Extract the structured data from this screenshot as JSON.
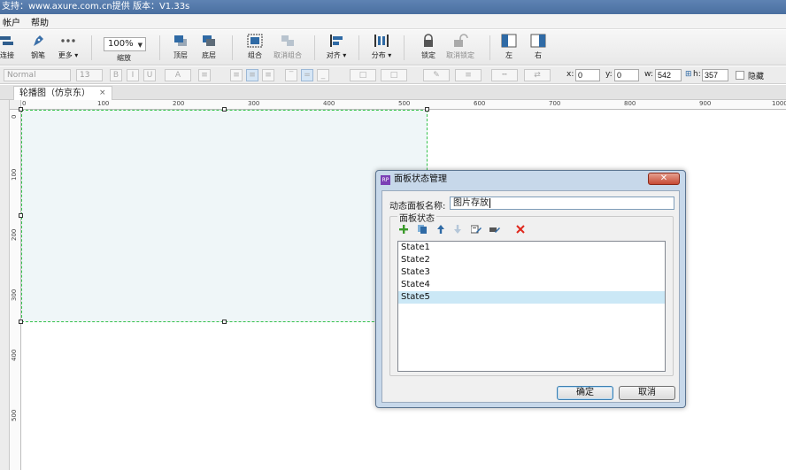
{
  "titlebar": {
    "text": "支持：www.axure.com.cn提供 版本：V1.33s"
  },
  "menu": {
    "items": [
      "帐户",
      "帮助"
    ]
  },
  "toolbar": {
    "buttons": {
      "connect": "连接",
      "pen": "钢笔",
      "more": "更多 ▾",
      "zoom_label": "缩放",
      "top": "顶层",
      "bottom": "底层",
      "group": "组合",
      "ungroup": "取消组合",
      "align": "对齐 ▾",
      "distribute": "分布 ▾",
      "lock": "锁定",
      "unlock": "取消锁定",
      "left": "左",
      "right": "右"
    },
    "zoom_value": "100%"
  },
  "format": {
    "font_style": "Normal",
    "font_size": "13",
    "bold": "B",
    "italic": "I",
    "underline": "U",
    "font_color": "A",
    "x_label": "x:",
    "x_value": "0",
    "y_label": "y:",
    "y_value": "0",
    "w_label": "w:",
    "w_value": "542",
    "h_label": "h:",
    "h_value": "357",
    "hide_label": "隐藏"
  },
  "tab": {
    "label": "轮播图（仿京东）",
    "close": "×"
  },
  "ruler": {
    "top": [
      "0",
      "100",
      "200",
      "300",
      "400",
      "500",
      "600",
      "700",
      "800",
      "900",
      "1000"
    ],
    "left": [
      "0",
      "100",
      "200",
      "300",
      "400",
      "500"
    ]
  },
  "dialog": {
    "title": "面板状态管理",
    "app_icon": "RP",
    "close": "✕",
    "name_label": "动态面板名称:",
    "name_value": "图片存放",
    "group_label": "面板状态",
    "states": [
      "State1",
      "State2",
      "State3",
      "State4",
      "State5"
    ],
    "selected_index": 4,
    "ok": "确定",
    "cancel": "取消"
  },
  "colors": {
    "selection_blue": "#cbe8f6",
    "panel_fill": "#eff6f8",
    "panel_border": "#35c24b"
  }
}
